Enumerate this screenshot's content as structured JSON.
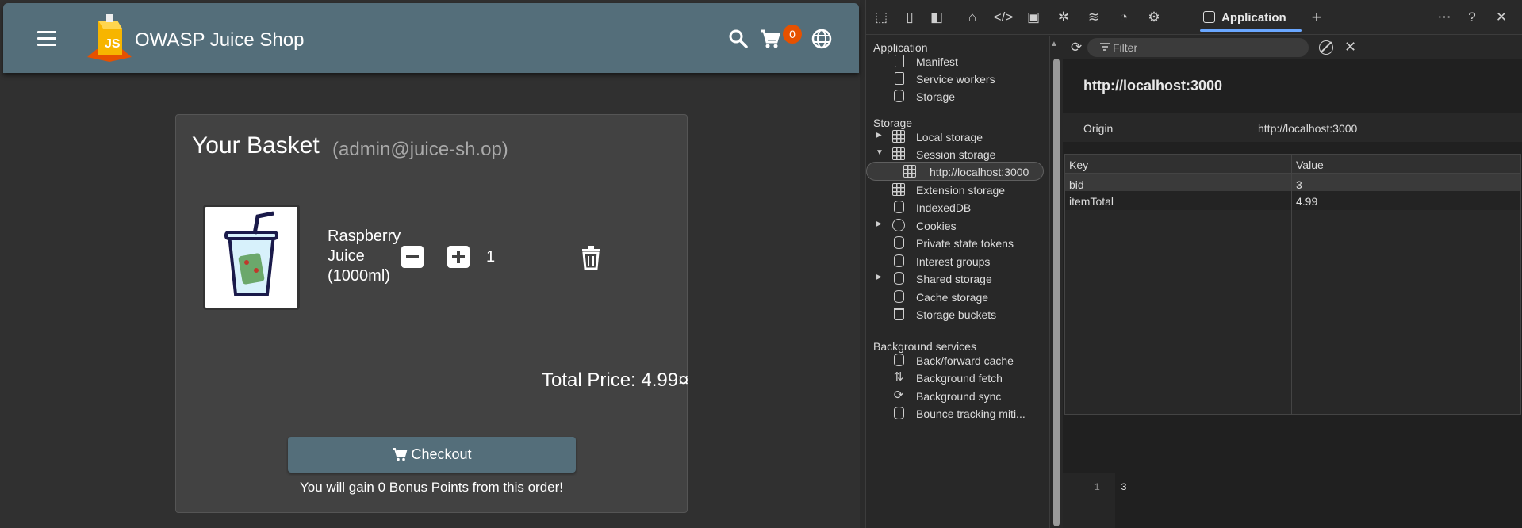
{
  "app": {
    "title": "OWASP Juice Shop",
    "cart_count": "0",
    "colors": {
      "toolbar": "#546e7a",
      "badge": "#e65100",
      "card": "#424242",
      "background": "#303030"
    }
  },
  "basket": {
    "title": "Your Basket",
    "user": "(admin@juice-sh.op)",
    "item": {
      "name": "Raspberry Juice (1000ml)",
      "quantity": "1"
    },
    "total": "Total Price: 4.99¤",
    "checkout_label": "Checkout",
    "bonus": "You will gain 0 Bonus Points from this order!"
  },
  "devtools": {
    "active_tab": "Application",
    "toolbar_icons": [
      "inspect-icon",
      "device-toolbar-icon",
      "dock-icon",
      "home-icon",
      "elements-icon",
      "console-icon",
      "bug-icon",
      "network-icon",
      "performance-icon",
      "cpu-icon",
      "application-icon",
      "add-tab-icon",
      "more-icon",
      "help-icon",
      "close-icon"
    ],
    "sidebar": {
      "sections": [
        {
          "title": "Application",
          "items": [
            "Manifest",
            "Service workers",
            "Storage"
          ]
        },
        {
          "title": "Storage",
          "items": [
            "Local storage",
            "Session storage",
            "http://localhost:3000",
            "Extension storage",
            "IndexedDB",
            "Cookies",
            "Private state tokens",
            "Interest groups",
            "Shared storage",
            "Cache storage",
            "Storage buckets"
          ]
        },
        {
          "title": "Background services",
          "items": [
            "Back/forward cache",
            "Background fetch",
            "Background sync",
            "Bounce tracking miti..."
          ]
        }
      ]
    },
    "filter_placeholder": "Filter",
    "origin_title": "http://localhost:3000",
    "origin": {
      "label": "Origin",
      "value": "http://localhost:3000"
    },
    "table": {
      "headers": [
        "Key",
        "Value"
      ],
      "rows": [
        {
          "key": "bid",
          "value": "3"
        },
        {
          "key": "itemTotal",
          "value": "4.99"
        }
      ]
    },
    "preview": {
      "line": "1",
      "value": "3"
    }
  }
}
